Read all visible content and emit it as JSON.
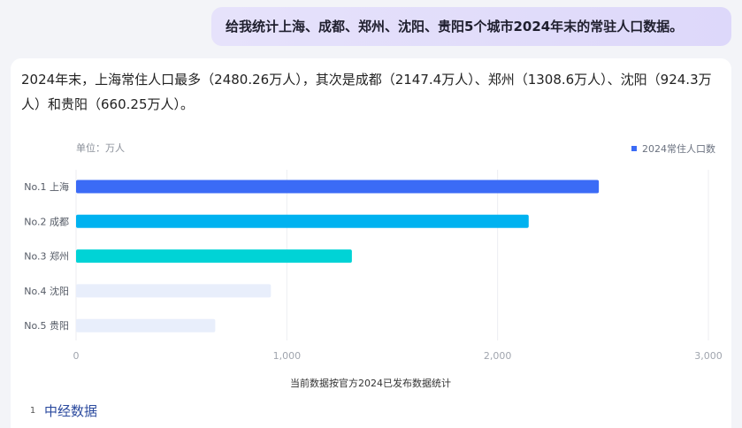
{
  "user_message": "给我统计上海、成都、郑州、沈阳、贵阳5个城市2024年末的常驻人口数据。",
  "answer_text": "2024年末，上海常住人口最多（2480.26万人），其次是成都（2147.4万人）、郑州（1308.6万人）、沈阳（924.3万人）和贵阳（660.25万人）。",
  "colors": {
    "bar_1": "#3b6bf6",
    "bar_2": "#00b2f0",
    "bar_3": "#00d3d6",
    "bar_faded": "#e8eefb",
    "legend_marker": "#3b6bf6"
  },
  "chart_data": {
    "type": "bar",
    "orientation": "horizontal",
    "unit_label": "单位：万人",
    "legend": [
      "2024常住人口数"
    ],
    "legend_position": "top-right",
    "categories": [
      "No.1 上海",
      "No.2 成都",
      "No.3 郑州",
      "No.4 沈阳",
      "No.5 贵阳"
    ],
    "series": [
      {
        "name": "2024常住人口数",
        "values": [
          2480.26,
          2147.4,
          1308.6,
          924.3,
          660.25
        ]
      }
    ],
    "xlim": [
      0,
      3000
    ],
    "xticks": [
      0,
      1000,
      2000,
      3000
    ],
    "xtick_labels": [
      "0",
      "1,000",
      "2,000",
      "3,000"
    ],
    "grid": true,
    "footnote": "当前数据按官方2024已发布数据统计"
  },
  "source": {
    "number": "1",
    "name": "中经数据"
  }
}
